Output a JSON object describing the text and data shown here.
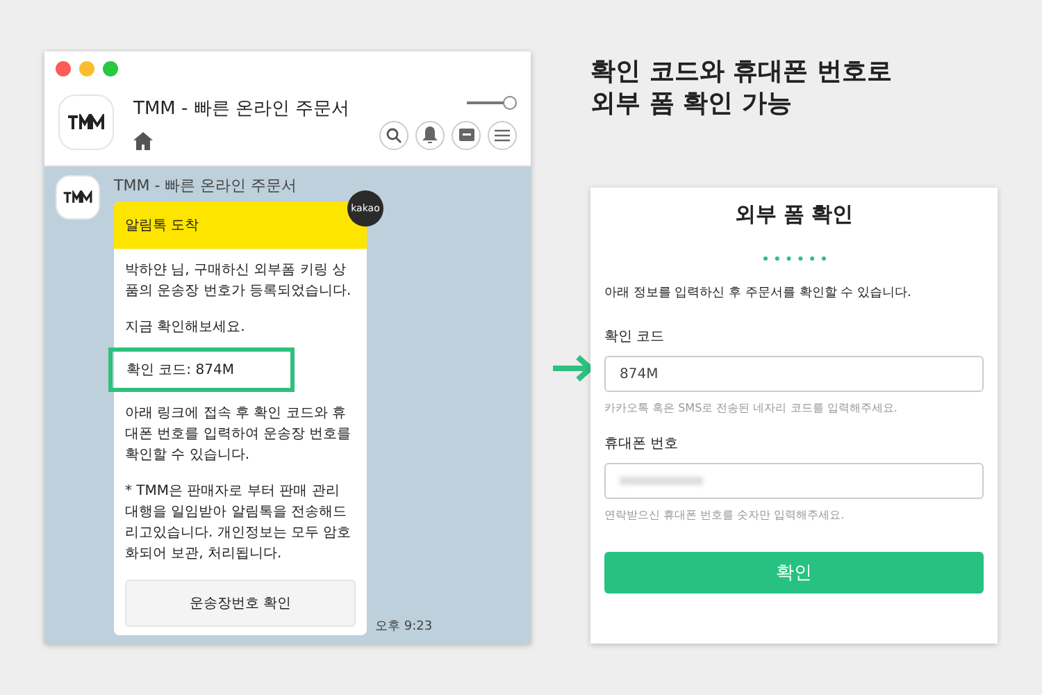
{
  "chat_window": {
    "title": "TMM - 빠른 온라인 주문서",
    "slider": {
      "level": 1
    },
    "message": {
      "sender": "TMM - 빠른 온라인 주문서",
      "badge": "kakao",
      "header": "알림톡 도착",
      "paragraphs": [
        {
          "kind": "text",
          "text": "박하얀 님, 구매하신 외부폼 키링 상품의 운송장 번호가 등록되었습니다."
        },
        {
          "kind": "text",
          "text": "지금 확인해보세요."
        },
        {
          "kind": "highlight",
          "text": "확인 코드: 874M"
        },
        {
          "kind": "text",
          "text": "아래 링크에 접속 후 확인 코드와 휴대폰 번호를 입력하여 운송장 번호를 확인할 수 있습니다."
        },
        {
          "kind": "text",
          "text": "* TMM은 판매자로 부터 판매 관리 대행을 일임받아 알림톡을 전송해드리고있습니다. 개인정보는 모두 암호화되어 보관, 처리됩니다."
        }
      ],
      "button": "운송장번호 확인",
      "time": "오후 9:23"
    }
  },
  "headline": [
    "확인 코드와 휴대폰 번호로",
    "외부 폼 확인 가능"
  ],
  "form": {
    "title": "외부 폼 확인",
    "intro": "아래 정보를 입력하신 후 주문서를 확인할 수 있습니다.",
    "fields": [
      {
        "label": "확인 코드",
        "value": "874M",
        "redacted": false,
        "hint": "카카오톡 혹은 SMS로 전송된 네자리 코드를 입력해주세요."
      },
      {
        "label": "휴대폰 번호",
        "redacted": true,
        "hint": "연락받으신 휴대폰 번호를 숫자만 입력해주세요."
      }
    ],
    "button": "확인"
  }
}
